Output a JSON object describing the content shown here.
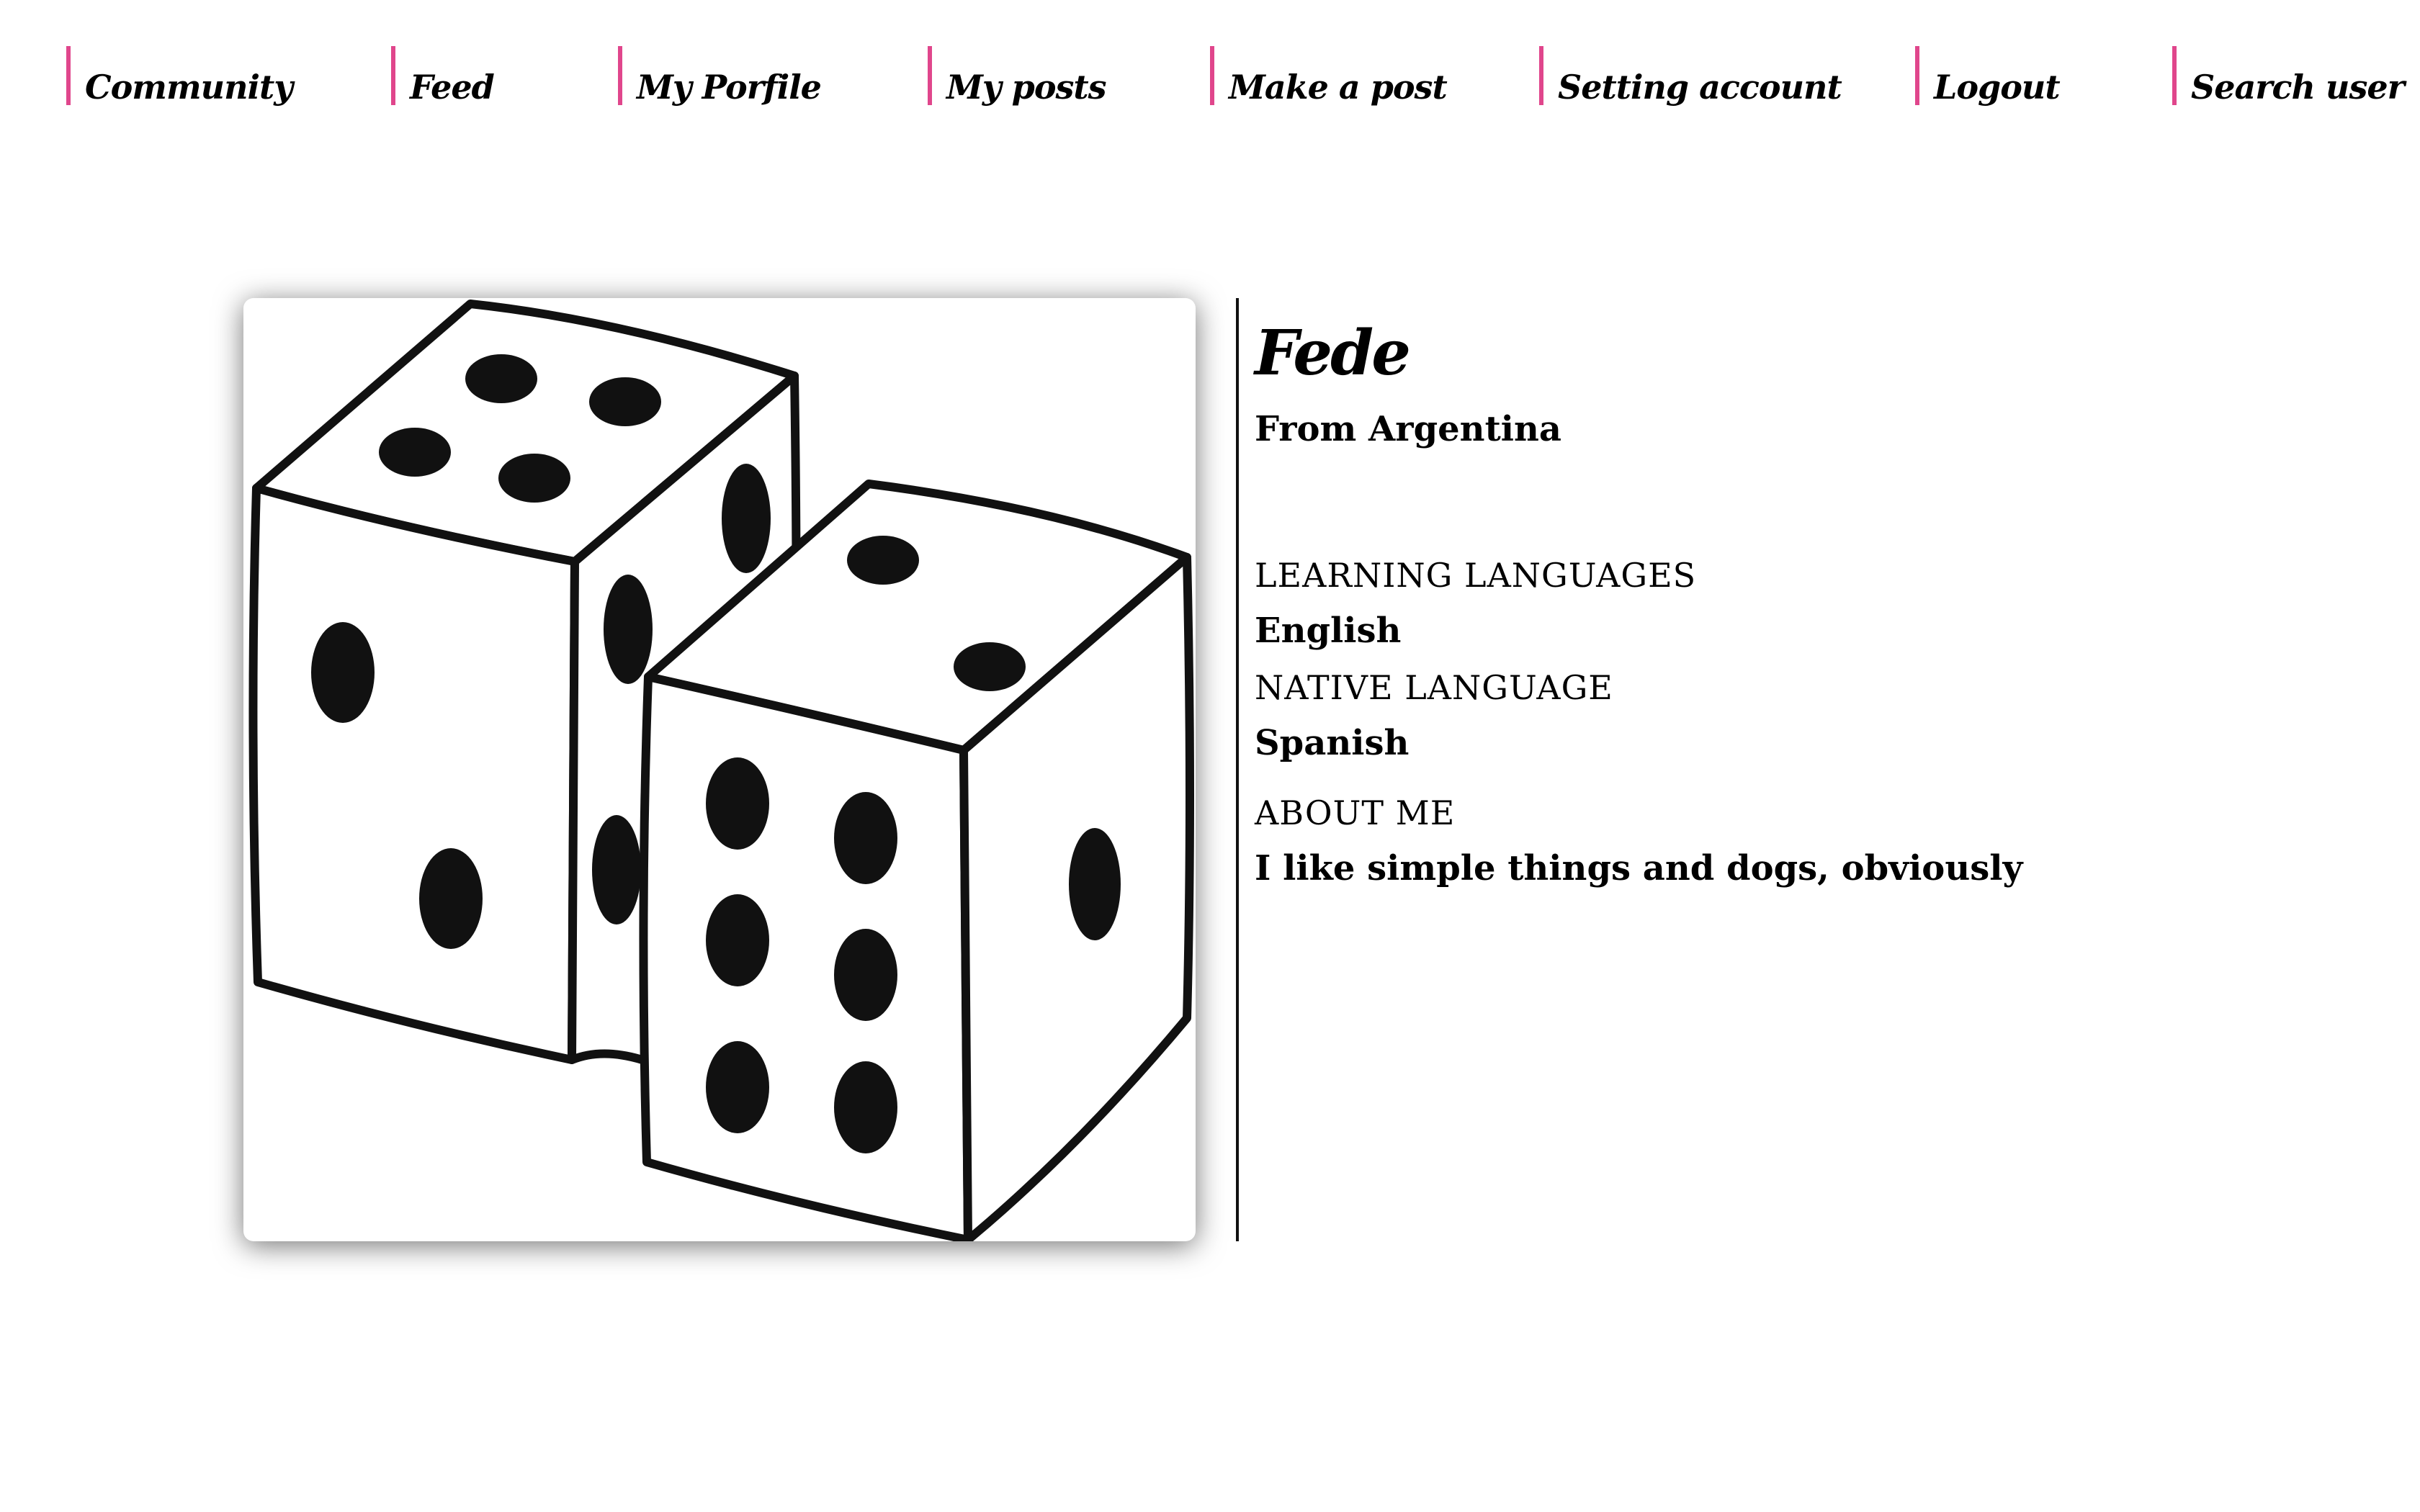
{
  "nav": {
    "items": [
      {
        "label": "Community"
      },
      {
        "label": "Feed"
      },
      {
        "label": "My Porfile"
      },
      {
        "label": "My posts"
      },
      {
        "label": "Make a post"
      },
      {
        "label": "Setting account"
      },
      {
        "label": "Logout"
      },
      {
        "label": "Search user"
      }
    ],
    "accent_color": "#e0468c"
  },
  "profile": {
    "name": "Fede",
    "origin": "From Argentina",
    "photo_icon": "dice-image",
    "learning_label": "LEARNING LANGUAGES",
    "learning_value": "English",
    "native_label": "NATIVE LANGUAGE",
    "native_value": "Spanish",
    "about_label": "ABOUT ME",
    "about_value": "I like simple things and dogs, obviously"
  }
}
